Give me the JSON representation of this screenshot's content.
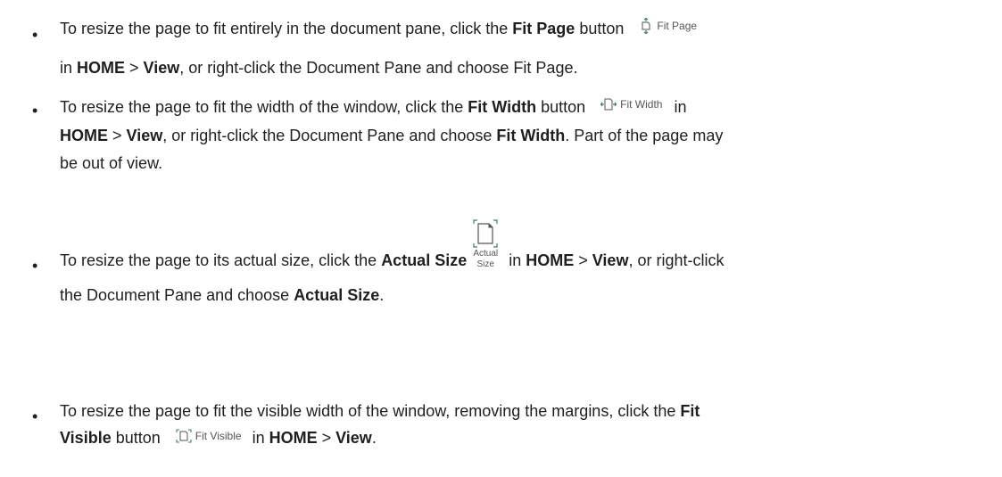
{
  "bullets": [
    {
      "p1": "To resize the page to fit entirely in the document pane, click the ",
      "b1": "Fit Page",
      "p2": " button",
      "btn_label": "Fit Page",
      "line2_p1": "in ",
      "home": "HOME",
      "gt": " > ",
      "view": "View",
      "line2_p2": ", or right-click the Document Pane and choose Fit Page."
    },
    {
      "p1": "To resize the page to fit the width of the window, click the ",
      "b1": "Fit Width",
      "p2": " button",
      "btn_label": "Fit Width",
      "p3": "in",
      "home": "HOME",
      "gt": " > ",
      "view": "View",
      "p4": ", or right-click the Document Pane and choose ",
      "b2": "Fit Width",
      "p5": ". Part of the page may",
      "line3": "be out of view."
    },
    {
      "p1": "To resize the page to its actual size, click the ",
      "b1": "Actual Size",
      "icon_label_1": "Actual",
      "icon_label_2": "Size",
      "p2": " in ",
      "home": "HOME",
      "gt": " > ",
      "view": "View",
      "p3": ", or right-click",
      "line2_p1": "the Document Pane and choose ",
      "b2": "Actual Size",
      "line2_p2": "."
    },
    {
      "p1": "To resize the page to fit the visible width of the window, removing the margins, click the ",
      "b1": "Fit",
      "b1_line2": "Visible",
      "p2": " button",
      "btn_label": "Fit Visible",
      "p3": " in ",
      "home": "HOME",
      "gt": " > ",
      "view": "View",
      "p4": "."
    }
  ],
  "colors": {
    "icon_green": "#2e8b57",
    "text": "#1f1f1f"
  }
}
